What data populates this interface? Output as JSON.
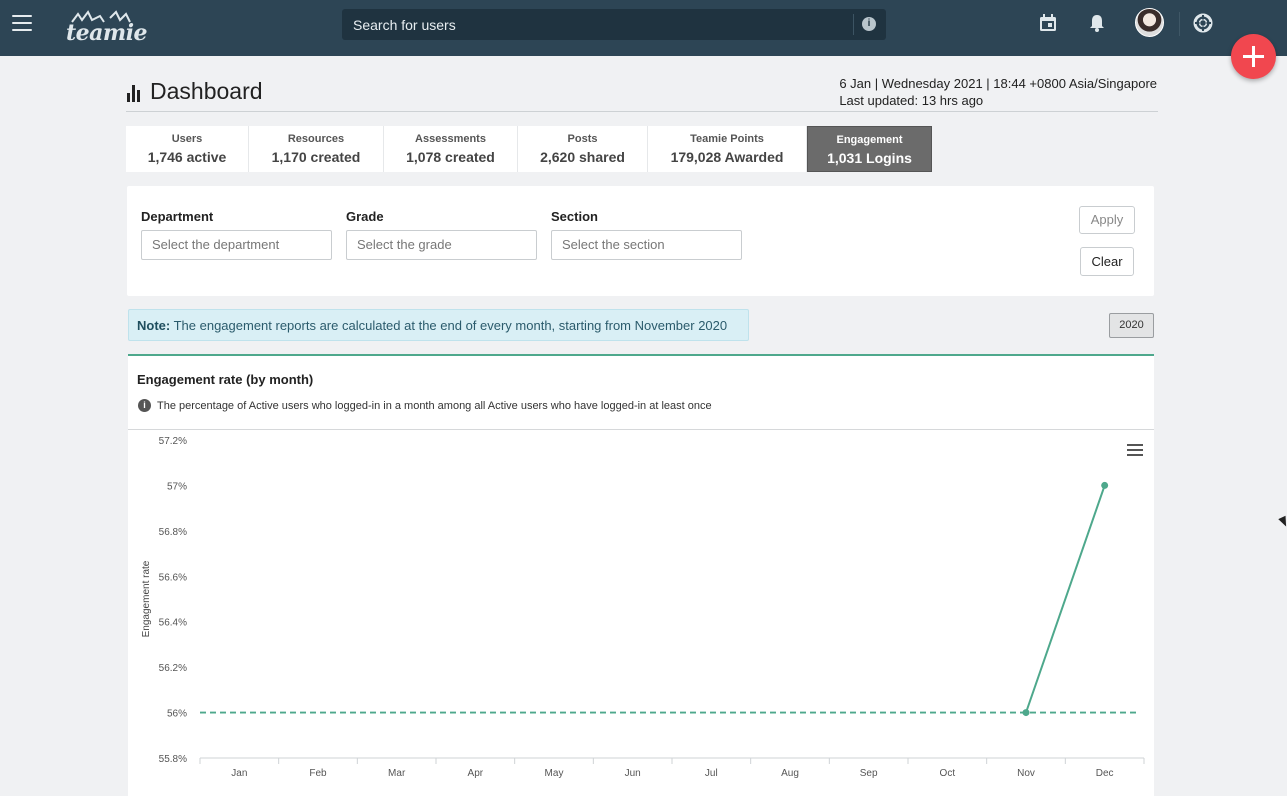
{
  "topbar": {
    "logo_text": "teamie",
    "search_placeholder": "Search for users",
    "icons": [
      "menu-icon",
      "calendar-icon",
      "bell-icon",
      "avatar",
      "help-lifebuoy-icon",
      "add-icon"
    ]
  },
  "header": {
    "title": "Dashboard",
    "datetime": "6 Jan | Wednesday 2021 | 18:44 +0800 Asia/Singapore",
    "last_updated": "Last updated: 13 hrs ago"
  },
  "tabs": [
    {
      "label": "Users",
      "value": "1,746 active"
    },
    {
      "label": "Resources",
      "value": "1,170 created"
    },
    {
      "label": "Assessments",
      "value": "1,078 created"
    },
    {
      "label": "Posts",
      "value": "2,620 shared"
    },
    {
      "label": "Teamie Points",
      "value": "179,028 Awarded"
    },
    {
      "label": "Engagement",
      "value": "1,031 Logins",
      "active": true
    }
  ],
  "filters": {
    "department": {
      "label": "Department",
      "placeholder": "Select the department"
    },
    "grade": {
      "label": "Grade",
      "placeholder": "Select the grade"
    },
    "section": {
      "label": "Section",
      "placeholder": "Select the section"
    },
    "apply_label": "Apply",
    "clear_label": "Clear"
  },
  "note": {
    "prefix": "Note:",
    "text": " The engagement reports are calculated at the end of every month, starting from November 2020"
  },
  "year_button": "2020",
  "chart": {
    "title": "Engagement rate (by month)",
    "description": "The percentage of Active users who logged-in in a month among all Active users who have logged-in at least once"
  },
  "colors": {
    "topbar": "#2d4555",
    "accent": "#4ea88c",
    "fab": "#f1474f"
  },
  "chart_data": {
    "type": "line",
    "categories": [
      "Jan",
      "Feb",
      "Mar",
      "Apr",
      "May",
      "Jun",
      "Jul",
      "Aug",
      "Sep",
      "Oct",
      "Nov",
      "Dec"
    ],
    "series": [
      {
        "values": [
          null,
          null,
          null,
          null,
          null,
          null,
          null,
          null,
          null,
          null,
          56,
          57
        ]
      }
    ],
    "reference_line": 56,
    "ylabel": "Engagement rate",
    "ylim": [
      55.8,
      57.2
    ],
    "yticks": [
      "57.2%",
      "57%",
      "56.8%",
      "56.6%",
      "56.4%",
      "56.2%",
      "56%",
      "55.8%"
    ],
    "grid": false,
    "legend": "none"
  }
}
